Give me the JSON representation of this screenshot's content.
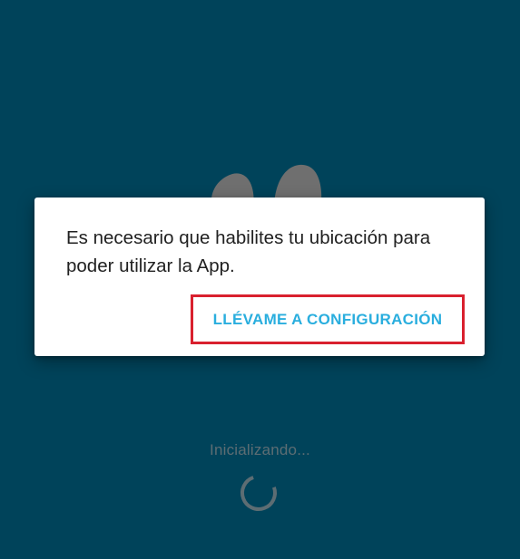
{
  "dialog": {
    "message": "Es necesario que habilites tu ubicación para poder utilizar la App.",
    "action_label": "LLÉVAME A CONFIGURACIÓN"
  },
  "loading": {
    "status_text": "Inicializando..."
  },
  "colors": {
    "background": "#00435a",
    "accent": "#2aaede",
    "highlight_border": "#d9202e",
    "logo_gray": "#6f6f6f"
  },
  "icons": {
    "logo": "app-logo-icon",
    "spinner": "loading-spinner-icon"
  }
}
